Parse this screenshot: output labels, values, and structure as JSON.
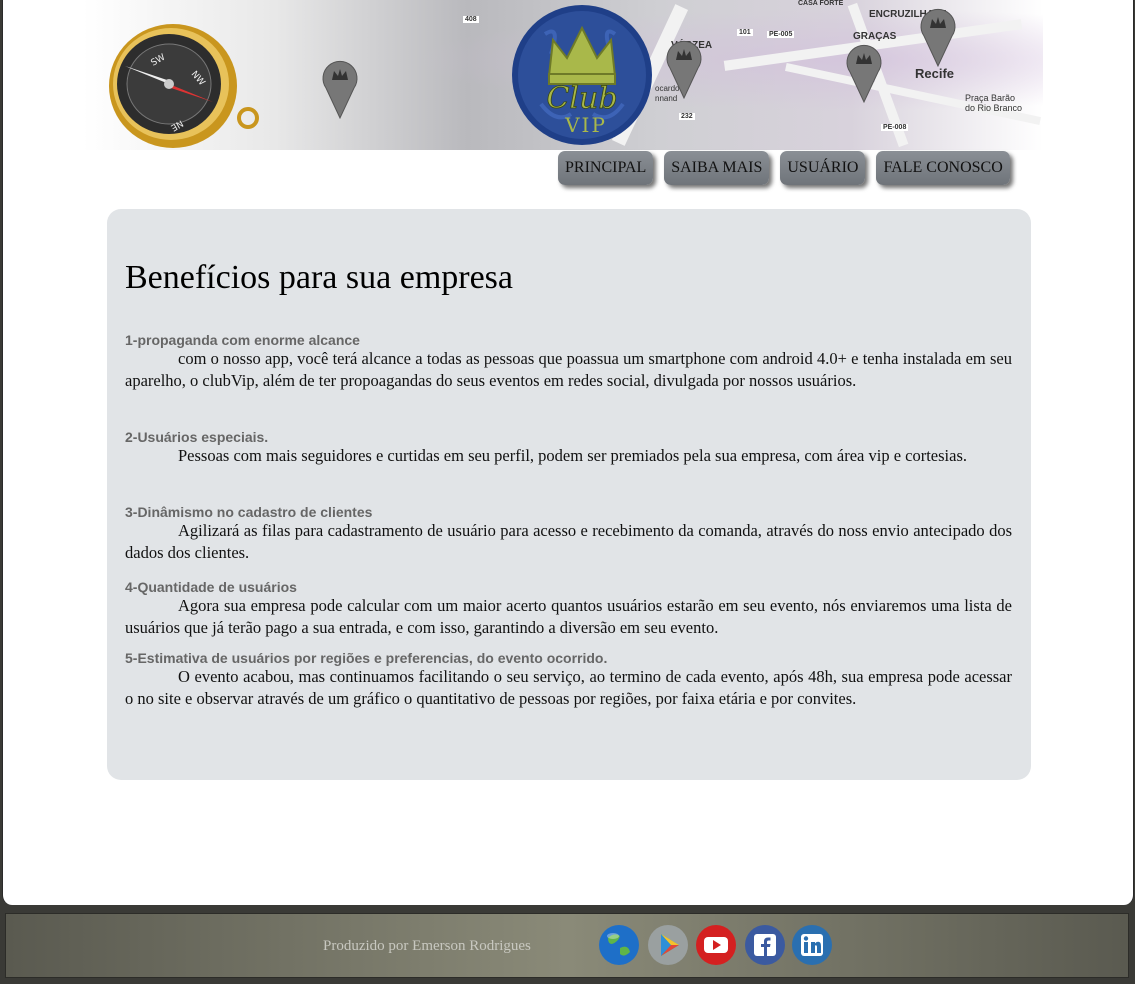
{
  "header": {
    "logo_text_1": "Club",
    "logo_text_2": "VIP",
    "map_labels": [
      "CASA FORTE",
      "ENCRUZILHADA",
      "GRAÇAS",
      "VÁRZEA",
      "Recife",
      "Praça Barão",
      "do Rio Branco",
      "408",
      "101",
      "PE-005",
      "232",
      "PE-008",
      "ocardo",
      "nnand"
    ]
  },
  "nav": {
    "items": [
      "PRINCIPAL",
      "SAIBA MAIS",
      "USUÁRIO",
      "FALE CONOSCO"
    ]
  },
  "content": {
    "title": "Benefícios para sua empresa",
    "sections": [
      {
        "heading": "1-propaganda com enorme alcance",
        "text": "com o nosso app, você terá alcance a todas as pessoas que poassua um smartphone com android 4.0+ e tenha instalada em seu aparelho, o clubVip, além de ter propoagandas do seus eventos em redes social, divulgada por nossos usuários."
      },
      {
        "heading": "2-Usuários especiais.",
        "text": "Pessoas com mais seguidores e curtidas em seu perfil, podem ser premiados pela sua empresa, com área vip e cortesias."
      },
      {
        "heading": "3-Dinâmismo no cadastro de clientes",
        "text": "Agilizará as filas para cadastramento de usuário para acesso e recebimento da comanda, através do noss envio antecipado dos dados dos clientes."
      },
      {
        "heading": "4-Quantidade de usuários",
        "text": "Agora sua empresa pode calcular com um maior acerto quantos usuários estarão em seu evento, nós enviaremos uma lista de usuários que já terão pago a sua entrada, e com isso, garantindo a diversão em seu evento."
      },
      {
        "heading": "5-Estimativa de usuários por regiões e preferencias, do evento ocorrido.",
        "text": "O evento acabou, mas continuamos facilitando o seu serviço, ao termino de cada evento, após 48h, sua empresa pode acessar o no site e observar através de um gráfico o quantitativo de pessoas por regiões, por faixa etária e por convites."
      }
    ]
  },
  "footer": {
    "credit": "Produzido por Emerson Rodrigues",
    "social_icons": [
      "globe-icon",
      "google-play-icon",
      "youtube-icon",
      "facebook-icon",
      "linkedin-icon"
    ]
  },
  "colors": {
    "content_bg": "#e1e4e7",
    "nav_button": "#7c8187",
    "heading_gray": "#666666",
    "footer_bg": "#6e6e60",
    "logo_blue": "#2d4f9a",
    "logo_gold": "#a9b84a"
  }
}
